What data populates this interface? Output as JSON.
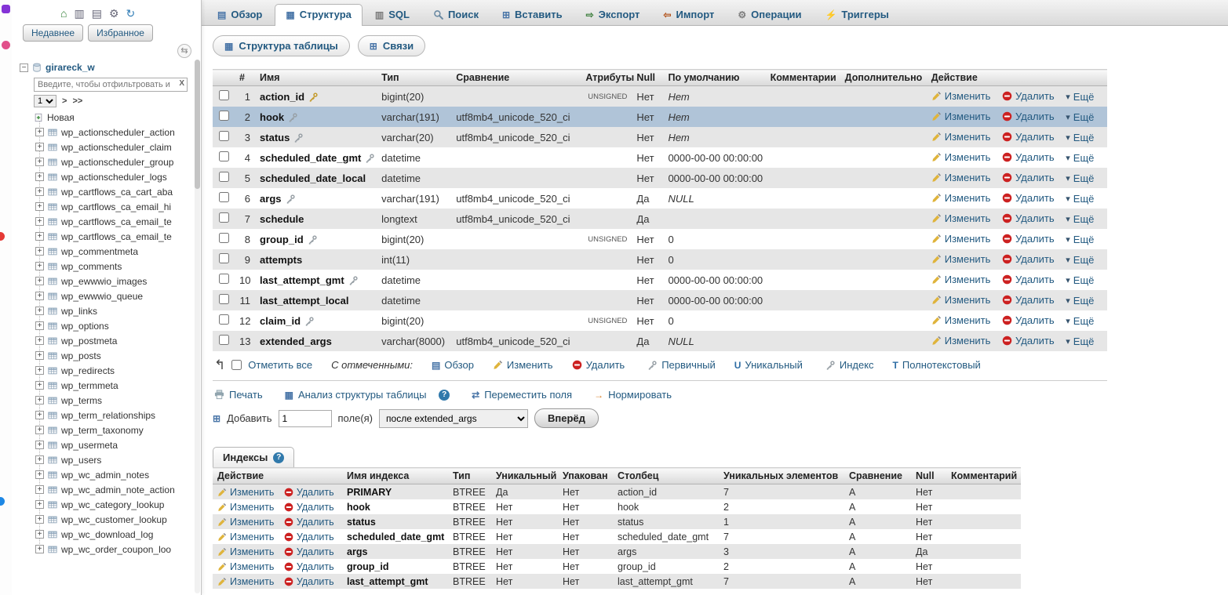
{
  "icons": {
    "home": "⌂",
    "sql_window": "▥",
    "docs": "▤",
    "settings": "⚙",
    "refresh": "↻",
    "collapse": "⇆",
    "browse": "▤",
    "structure": "▦",
    "sql": "▥",
    "insert": "⊞",
    "export": "⇨",
    "import": "⇦",
    "operations": "⚙",
    "triggers": "⚡",
    "relations": "⊞",
    "more_chevron": "▾",
    "check_all_arrow": "↰",
    "move": "⇄",
    "normalize": "→",
    "unique": "U",
    "fulltext": "T",
    "help": "?",
    "expand_plus": "+",
    "collapse_minus": "−",
    "page_next": ">",
    "page_last": ">>"
  },
  "colors": {
    "accent_link": "#235a81",
    "selected_row": "#b0c4d8",
    "stripe_row": "#e6e6e6"
  },
  "sidebar": {
    "recent_label": "Недавнее",
    "favorites_label": "Избранное",
    "database_name": "girareck_w",
    "filter_placeholder": "Введите, чтобы отфильтровать и",
    "filter_clear": "X",
    "page_selected": "1",
    "new_table_label": "Новая",
    "tables": [
      "wp_actionscheduler_action",
      "wp_actionscheduler_claim",
      "wp_actionscheduler_group",
      "wp_actionscheduler_logs",
      "wp_cartflows_ca_cart_aba",
      "wp_cartflows_ca_email_hi",
      "wp_cartflows_ca_email_te",
      "wp_cartflows_ca_email_te",
      "wp_commentmeta",
      "wp_comments",
      "wp_ewwwio_images",
      "wp_ewwwio_queue",
      "wp_links",
      "wp_options",
      "wp_postmeta",
      "wp_posts",
      "wp_redirects",
      "wp_termmeta",
      "wp_terms",
      "wp_term_relationships",
      "wp_term_taxonomy",
      "wp_usermeta",
      "wp_users",
      "wp_wc_admin_notes",
      "wp_wc_admin_note_action",
      "wp_wc_category_lookup",
      "wp_wc_customer_lookup",
      "wp_wc_download_log",
      "wp_wc_order_coupon_loo"
    ]
  },
  "tabs": [
    {
      "label": "Обзор"
    },
    {
      "label": "Структура"
    },
    {
      "label": "SQL"
    },
    {
      "label": "Поиск"
    },
    {
      "label": "Вставить"
    },
    {
      "label": "Экспорт"
    },
    {
      "label": "Импорт"
    },
    {
      "label": "Операции"
    },
    {
      "label": "Триггеры"
    }
  ],
  "structure": {
    "buttons": {
      "table_structure": "Структура таблицы",
      "relations": "Связи"
    },
    "headers": {
      "num": "#",
      "name": "Имя",
      "type": "Тип",
      "collation": "Сравнение",
      "attributes": "Атрибуты",
      "null": "Null",
      "default": "По умолчанию",
      "comments": "Комментарии",
      "extra": "Дополнительно",
      "action": "Действие"
    },
    "row_actions": {
      "change": "Изменить",
      "drop": "Удалить",
      "more": "Ещё"
    },
    "rows": [
      {
        "num": "1",
        "name": "action_id",
        "type": "bigint(20)",
        "collation": "",
        "attributes": "UNSIGNED",
        "null": "Нет",
        "default": "Нет",
        "default_italic": true,
        "key_primary": true
      },
      {
        "num": "2",
        "name": "hook",
        "type": "varchar(191)",
        "collation": "utf8mb4_unicode_520_ci",
        "attributes": "",
        "null": "Нет",
        "default": "Нет",
        "default_italic": true,
        "key_index": true,
        "selected": true
      },
      {
        "num": "3",
        "name": "status",
        "type": "varchar(20)",
        "collation": "utf8mb4_unicode_520_ci",
        "attributes": "",
        "null": "Нет",
        "default": "Нет",
        "default_italic": true,
        "key_index": true
      },
      {
        "num": "4",
        "name": "scheduled_date_gmt",
        "type": "datetime",
        "collation": "",
        "attributes": "",
        "null": "Нет",
        "default": "0000-00-00 00:00:00",
        "key_index": true
      },
      {
        "num": "5",
        "name": "scheduled_date_local",
        "type": "datetime",
        "collation": "",
        "attributes": "",
        "null": "Нет",
        "default": "0000-00-00 00:00:00"
      },
      {
        "num": "6",
        "name": "args",
        "type": "varchar(191)",
        "collation": "utf8mb4_unicode_520_ci",
        "attributes": "",
        "null": "Да",
        "default": "NULL",
        "default_italic": true,
        "key_index": true
      },
      {
        "num": "7",
        "name": "schedule",
        "type": "longtext",
        "collation": "utf8mb4_unicode_520_ci",
        "attributes": "",
        "null": "Да",
        "default": ""
      },
      {
        "num": "8",
        "name": "group_id",
        "type": "bigint(20)",
        "collation": "",
        "attributes": "UNSIGNED",
        "null": "Нет",
        "default": "0",
        "key_index": true
      },
      {
        "num": "9",
        "name": "attempts",
        "type": "int(11)",
        "collation": "",
        "attributes": "",
        "null": "Нет",
        "default": "0"
      },
      {
        "num": "10",
        "name": "last_attempt_gmt",
        "type": "datetime",
        "collation": "",
        "attributes": "",
        "null": "Нет",
        "default": "0000-00-00 00:00:00",
        "key_index": true
      },
      {
        "num": "11",
        "name": "last_attempt_local",
        "type": "datetime",
        "collation": "",
        "attributes": "",
        "null": "Нет",
        "default": "0000-00-00 00:00:00"
      },
      {
        "num": "12",
        "name": "claim_id",
        "type": "bigint(20)",
        "collation": "",
        "attributes": "UNSIGNED",
        "null": "Нет",
        "default": "0",
        "key_index": true
      },
      {
        "num": "13",
        "name": "extended_args",
        "type": "varchar(8000)",
        "collation": "utf8mb4_unicode_520_ci",
        "attributes": "",
        "null": "Да",
        "default": "NULL",
        "default_italic": true
      }
    ],
    "check_all": "Отметить все",
    "with_selected": {
      "label": "С отмеченными:",
      "browse": "Обзор",
      "change": "Изменить",
      "drop": "Удалить",
      "primary": "Первичный",
      "unique": "Уникальный",
      "index": "Индекс",
      "fulltext": "Полнотекстовый"
    },
    "tools": {
      "print": "Печать",
      "analyze": "Анализ структуры таблицы",
      "move": "Переместить поля",
      "normalize": "Нормировать"
    },
    "add": {
      "label": "Добавить",
      "count": "1",
      "columns_label": "поле(я)",
      "position": "после extended_args",
      "go": "Вперёд"
    }
  },
  "indexes": {
    "legend": "Индексы",
    "headers": [
      "Действие",
      "Имя индекса",
      "Тип",
      "Уникальный",
      "Упакован",
      "Столбец",
      "Уникальных элементов",
      "Сравнение",
      "Null",
      "Комментарий"
    ],
    "row_actions": {
      "change": "Изменить",
      "drop": "Удалить"
    },
    "rows": [
      {
        "keyname": "PRIMARY",
        "type": "BTREE",
        "unique": "Да",
        "packed": "Нет",
        "column": "action_id",
        "cardinality": "7",
        "collation": "A",
        "null": "Нет",
        "comment": ""
      },
      {
        "keyname": "hook",
        "type": "BTREE",
        "unique": "Нет",
        "packed": "Нет",
        "column": "hook",
        "cardinality": "2",
        "collation": "A",
        "null": "Нет",
        "comment": ""
      },
      {
        "keyname": "status",
        "type": "BTREE",
        "unique": "Нет",
        "packed": "Нет",
        "column": "status",
        "cardinality": "1",
        "collation": "A",
        "null": "Нет",
        "comment": ""
      },
      {
        "keyname": "scheduled_date_gmt",
        "type": "BTREE",
        "unique": "Нет",
        "packed": "Нет",
        "column": "scheduled_date_gmt",
        "cardinality": "7",
        "collation": "A",
        "null": "Нет",
        "comment": ""
      },
      {
        "keyname": "args",
        "type": "BTREE",
        "unique": "Нет",
        "packed": "Нет",
        "column": "args",
        "cardinality": "3",
        "collation": "A",
        "null": "Да",
        "comment": ""
      },
      {
        "keyname": "group_id",
        "type": "BTREE",
        "unique": "Нет",
        "packed": "Нет",
        "column": "group_id",
        "cardinality": "2",
        "collation": "A",
        "null": "Нет",
        "comment": ""
      },
      {
        "keyname": "last_attempt_gmt",
        "type": "BTREE",
        "unique": "Нет",
        "packed": "Нет",
        "column": "last_attempt_gmt",
        "cardinality": "7",
        "collation": "A",
        "null": "Нет",
        "comment": ""
      }
    ]
  }
}
